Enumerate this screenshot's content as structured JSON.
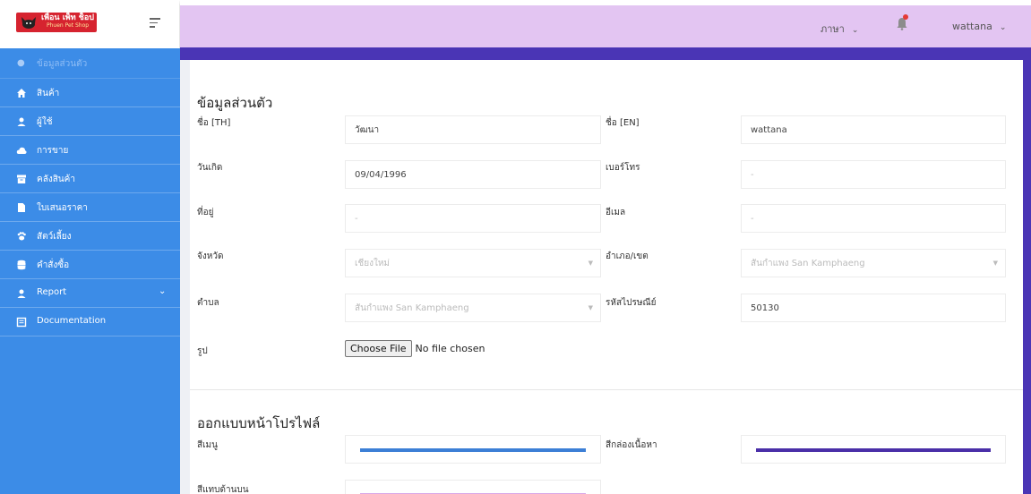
{
  "brand": {
    "logo_text": "เพื่อน เพ็ท ช็อป",
    "logo_sub": "Phuen Pet Shop"
  },
  "sidebar": {
    "profile_label": "ข้อมูลส่วนตัว",
    "items": [
      {
        "label": "สินค้า",
        "icon": "home-icon"
      },
      {
        "label": "ผู้ใช้",
        "icon": "user-icon"
      },
      {
        "label": "การขาย",
        "icon": "cloud-icon"
      },
      {
        "label": "คลังสินค้า",
        "icon": "archive-icon"
      },
      {
        "label": "ใบเสนอราคา",
        "icon": "file-icon"
      },
      {
        "label": "สัตว์เลี้ยง",
        "icon": "paw-icon"
      },
      {
        "label": "คำสั่งซื้อ",
        "icon": "database-icon"
      },
      {
        "label": "Report",
        "icon": "user-icon",
        "chevron": "⌄"
      },
      {
        "label": "Documentation",
        "icon": "book-icon"
      }
    ]
  },
  "topbar": {
    "language_label": "ภาษา",
    "username": "wattana"
  },
  "profile": {
    "section_title": "ข้อมูลส่วนตัว",
    "name_th_label": "ชื่อ [TH]",
    "name_th_value": "วัฒนา",
    "name_en_label": "ชื่อ [EN]",
    "name_en_value": "wattana",
    "birthday_label": "วันเกิด",
    "birthday_value": "09/04/1996",
    "phone_label": "เบอร์โทร",
    "phone_value": "-",
    "address_label": "ที่อยู่",
    "address_value": "-",
    "email_label": "อีเมล",
    "email_value": "-",
    "province_label": "จังหวัด",
    "province_value": "เชียงใหม่",
    "district_label": "อำเภอ/เขต",
    "district_value": "สันกำแพง San Kamphaeng",
    "subdistrict_label": "ตำบล",
    "subdistrict_value": "สันกำแพง San Kamphaeng",
    "postcode_label": "รหัสไปรษณีย์",
    "postcode_value": "50130",
    "photo_label": "รูป",
    "file_button": "Choose File",
    "file_status": "No file chosen"
  },
  "design": {
    "section_title": "ออกแบบหน้าโปรไฟล์",
    "menu_color_label": "สีเมนู",
    "menu_color": "#3c7fd6",
    "content_color_label": "สีกล่องเนื้อหา",
    "content_color": "#4a2fa8",
    "top_color_label": "สีแทบด้านบน",
    "top_color": "#d9a8e8"
  }
}
